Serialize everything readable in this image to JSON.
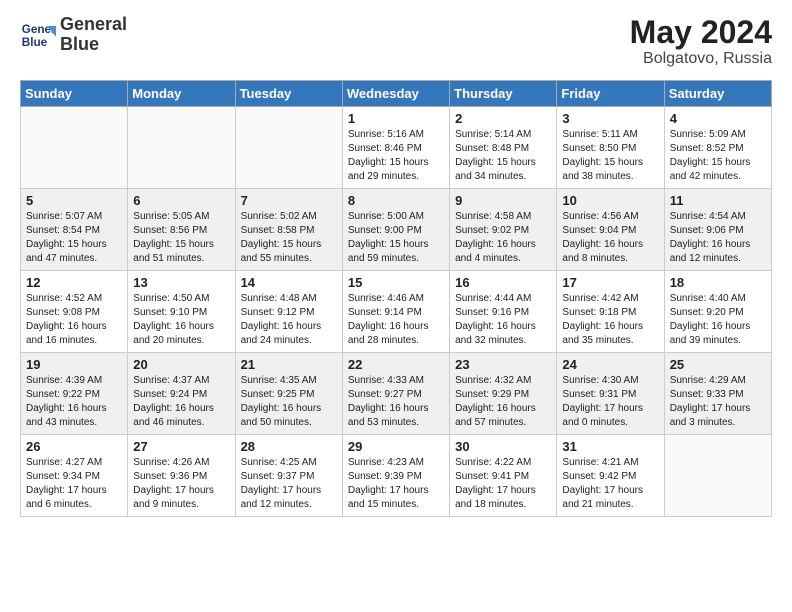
{
  "header": {
    "logo_line1": "General",
    "logo_line2": "Blue",
    "month_year": "May 2024",
    "location": "Bolgatovo, Russia"
  },
  "days_of_week": [
    "Sunday",
    "Monday",
    "Tuesday",
    "Wednesday",
    "Thursday",
    "Friday",
    "Saturday"
  ],
  "weeks": [
    [
      {
        "day": "",
        "info": ""
      },
      {
        "day": "",
        "info": ""
      },
      {
        "day": "",
        "info": ""
      },
      {
        "day": "1",
        "info": "Sunrise: 5:16 AM\nSunset: 8:46 PM\nDaylight: 15 hours\nand 29 minutes."
      },
      {
        "day": "2",
        "info": "Sunrise: 5:14 AM\nSunset: 8:48 PM\nDaylight: 15 hours\nand 34 minutes."
      },
      {
        "day": "3",
        "info": "Sunrise: 5:11 AM\nSunset: 8:50 PM\nDaylight: 15 hours\nand 38 minutes."
      },
      {
        "day": "4",
        "info": "Sunrise: 5:09 AM\nSunset: 8:52 PM\nDaylight: 15 hours\nand 42 minutes."
      }
    ],
    [
      {
        "day": "5",
        "info": "Sunrise: 5:07 AM\nSunset: 8:54 PM\nDaylight: 15 hours\nand 47 minutes."
      },
      {
        "day": "6",
        "info": "Sunrise: 5:05 AM\nSunset: 8:56 PM\nDaylight: 15 hours\nand 51 minutes."
      },
      {
        "day": "7",
        "info": "Sunrise: 5:02 AM\nSunset: 8:58 PM\nDaylight: 15 hours\nand 55 minutes."
      },
      {
        "day": "8",
        "info": "Sunrise: 5:00 AM\nSunset: 9:00 PM\nDaylight: 15 hours\nand 59 minutes."
      },
      {
        "day": "9",
        "info": "Sunrise: 4:58 AM\nSunset: 9:02 PM\nDaylight: 16 hours\nand 4 minutes."
      },
      {
        "day": "10",
        "info": "Sunrise: 4:56 AM\nSunset: 9:04 PM\nDaylight: 16 hours\nand 8 minutes."
      },
      {
        "day": "11",
        "info": "Sunrise: 4:54 AM\nSunset: 9:06 PM\nDaylight: 16 hours\nand 12 minutes."
      }
    ],
    [
      {
        "day": "12",
        "info": "Sunrise: 4:52 AM\nSunset: 9:08 PM\nDaylight: 16 hours\nand 16 minutes."
      },
      {
        "day": "13",
        "info": "Sunrise: 4:50 AM\nSunset: 9:10 PM\nDaylight: 16 hours\nand 20 minutes."
      },
      {
        "day": "14",
        "info": "Sunrise: 4:48 AM\nSunset: 9:12 PM\nDaylight: 16 hours\nand 24 minutes."
      },
      {
        "day": "15",
        "info": "Sunrise: 4:46 AM\nSunset: 9:14 PM\nDaylight: 16 hours\nand 28 minutes."
      },
      {
        "day": "16",
        "info": "Sunrise: 4:44 AM\nSunset: 9:16 PM\nDaylight: 16 hours\nand 32 minutes."
      },
      {
        "day": "17",
        "info": "Sunrise: 4:42 AM\nSunset: 9:18 PM\nDaylight: 16 hours\nand 35 minutes."
      },
      {
        "day": "18",
        "info": "Sunrise: 4:40 AM\nSunset: 9:20 PM\nDaylight: 16 hours\nand 39 minutes."
      }
    ],
    [
      {
        "day": "19",
        "info": "Sunrise: 4:39 AM\nSunset: 9:22 PM\nDaylight: 16 hours\nand 43 minutes."
      },
      {
        "day": "20",
        "info": "Sunrise: 4:37 AM\nSunset: 9:24 PM\nDaylight: 16 hours\nand 46 minutes."
      },
      {
        "day": "21",
        "info": "Sunrise: 4:35 AM\nSunset: 9:25 PM\nDaylight: 16 hours\nand 50 minutes."
      },
      {
        "day": "22",
        "info": "Sunrise: 4:33 AM\nSunset: 9:27 PM\nDaylight: 16 hours\nand 53 minutes."
      },
      {
        "day": "23",
        "info": "Sunrise: 4:32 AM\nSunset: 9:29 PM\nDaylight: 16 hours\nand 57 minutes."
      },
      {
        "day": "24",
        "info": "Sunrise: 4:30 AM\nSunset: 9:31 PM\nDaylight: 17 hours\nand 0 minutes."
      },
      {
        "day": "25",
        "info": "Sunrise: 4:29 AM\nSunset: 9:33 PM\nDaylight: 17 hours\nand 3 minutes."
      }
    ],
    [
      {
        "day": "26",
        "info": "Sunrise: 4:27 AM\nSunset: 9:34 PM\nDaylight: 17 hours\nand 6 minutes."
      },
      {
        "day": "27",
        "info": "Sunrise: 4:26 AM\nSunset: 9:36 PM\nDaylight: 17 hours\nand 9 minutes."
      },
      {
        "day": "28",
        "info": "Sunrise: 4:25 AM\nSunset: 9:37 PM\nDaylight: 17 hours\nand 12 minutes."
      },
      {
        "day": "29",
        "info": "Sunrise: 4:23 AM\nSunset: 9:39 PM\nDaylight: 17 hours\nand 15 minutes."
      },
      {
        "day": "30",
        "info": "Sunrise: 4:22 AM\nSunset: 9:41 PM\nDaylight: 17 hours\nand 18 minutes."
      },
      {
        "day": "31",
        "info": "Sunrise: 4:21 AM\nSunset: 9:42 PM\nDaylight: 17 hours\nand 21 minutes."
      },
      {
        "day": "",
        "info": ""
      }
    ]
  ]
}
